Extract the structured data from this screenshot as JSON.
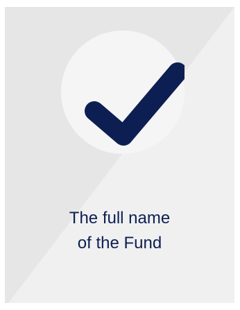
{
  "card": {
    "caption_line1": "The full name",
    "caption_line2": "of the Fund",
    "icon": "checkmark-icon",
    "colors": {
      "card_background": "#e6e6e6",
      "card_light_triangle": "#f0f0f0",
      "circle_background": "#f5f5f5",
      "checkmark": "#0d1f52",
      "text": "#0d1f52"
    }
  }
}
